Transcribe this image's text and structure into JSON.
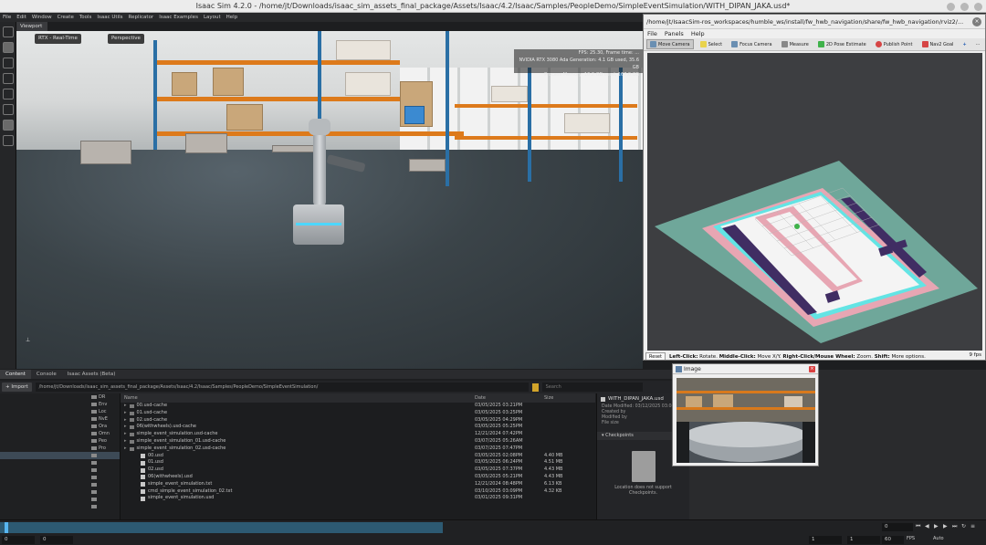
{
  "isaac": {
    "title": "Isaac Sim 4.2.0 - /home/jt/Downloads/isaac_sim_assets_final_package/Assets/Isaac/4.2/Isaac/Samples/PeopleDemo/SimpleEventSimulation/WITH_DIPAN_JAKA.usd*",
    "menu": [
      "File",
      "Edit",
      "Window",
      "Create",
      "Tools",
      "Isaac Utils",
      "Replicator",
      "Isaac Examples",
      "Layout",
      "Help"
    ],
    "viewport_tab": "Viewport",
    "viewport_buttons": {
      "render_mode": "RTX - Real-Time",
      "camera": "Perspective"
    },
    "perf": {
      "line1": "FPS: 25.30, Frame time: ...",
      "line2": "NVIDIA RTX 3080 Ada Generation: 4.1 GB used, 35.6 GB",
      "line3": "Process Memory: 10.2 GB used, 167.0 GB"
    }
  },
  "content": {
    "tabs": [
      "Content",
      "Console",
      "Isaac Assets (Beta)"
    ],
    "import_label": "+ Import",
    "path": "/home/jt/Downloads/isaac_sim_assets_final_package/Assets/Isaac/4.2/Isaac/Samples/PeopleDemo/SimpleEventSimulation/",
    "search_placeholder": "Search",
    "tree": [
      "DR",
      "Env",
      "Loc",
      "NvE",
      "Ora",
      "Omn",
      "Peo",
      "Pro",
      "",
      "",
      "",
      "",
      "",
      "",
      "",
      ""
    ],
    "columns": {
      "name": "Name",
      "date": "Date",
      "size": "Size"
    },
    "files": [
      {
        "name": "00.usd-cache",
        "date": "03/05/2025 03:21PM",
        "size": "",
        "kind": "folder"
      },
      {
        "name": "01.usd-cache",
        "date": "03/05/2025 03:25PM",
        "size": "",
        "kind": "folder"
      },
      {
        "name": "02.usd-cache",
        "date": "03/05/2025 04:29PM",
        "size": "",
        "kind": "folder"
      },
      {
        "name": "06(withwheels).usd-cache",
        "date": "03/05/2025 05:25PM",
        "size": "",
        "kind": "folder"
      },
      {
        "name": "simple_event_simulation.usd-cache",
        "date": "12/21/2024 07:42PM",
        "size": "",
        "kind": "folder"
      },
      {
        "name": "simple_event_simulation_01.usd-cache",
        "date": "03/07/2025 05:26AM",
        "size": "",
        "kind": "folder"
      },
      {
        "name": "simple_event_simulation_02.usd-cache",
        "date": "03/07/2025 07:47PM",
        "size": "",
        "kind": "folder"
      },
      {
        "name": "00.usd",
        "date": "03/05/2025 02:08PM",
        "size": "4.40 MB",
        "kind": "file"
      },
      {
        "name": "01.usd",
        "date": "03/05/2025 06:24PM",
        "size": "4.51 MB",
        "kind": "file"
      },
      {
        "name": "02.usd",
        "date": "03/05/2025 07:37PM",
        "size": "4.43 MB",
        "kind": "file"
      },
      {
        "name": "06(withwheels).usd",
        "date": "03/05/2025 05:21PM",
        "size": "4.43 MB",
        "kind": "file"
      },
      {
        "name": "simple_event_simulation.txt",
        "date": "12/21/2024 08:48PM",
        "size": "6.13 KB",
        "kind": "file"
      },
      {
        "name": "cmd_simple_event_simulation_02.txt",
        "date": "03/10/2025 03:09PM",
        "size": "4.32 KB",
        "kind": "file"
      },
      {
        "name": "simple_event_simulation.usd",
        "date": "03/01/2025 09:31PM",
        "size": "",
        "kind": "file"
      }
    ],
    "detail": {
      "name": "WITH_DIPAN_JAKA.usd",
      "date_modified": "Date Modified: 03/12/2025 03:08...",
      "created_by": "Created by",
      "modified_by": "Modified by",
      "file_size": "File size",
      "file_size_value": "11.7...",
      "checkpoints": "Checkpoints",
      "no_support_1": "Location does not support",
      "no_support_2": "Checkpoints."
    }
  },
  "timeline": {
    "start": "0",
    "start2": "0",
    "end": "1",
    "end2": "1",
    "current": "0",
    "fps_value": "60",
    "fps_label": "FPS",
    "auto": "Auto"
  },
  "rviz": {
    "title": "/home/jt/IsaacSim-ros_workspaces/humble_ws/install/fw_hwb_navigation/share/fw_hwb_navigation/rviz2/...",
    "menu": [
      "File",
      "Panels",
      "Help"
    ],
    "tools": [
      {
        "label": "Move Camera",
        "active": true
      },
      {
        "label": "Select",
        "active": false
      },
      {
        "label": "Focus Camera",
        "active": false
      },
      {
        "label": "Measure",
        "active": false
      },
      {
        "label": "2D Pose Estimate",
        "active": false
      },
      {
        "label": "Publish Point",
        "active": false
      },
      {
        "label": "Nav2 Goal",
        "active": false
      }
    ],
    "reset": "Reset",
    "status": {
      "left_bold": "Left-Click:",
      "left": " Rotate. ",
      "middle_bold": "Middle-Click:",
      "middle": " Move X/Y. ",
      "right_bold": "Right-Click/Mouse Wheel:",
      "right": " Zoom. ",
      "shift_bold": "Shift:",
      "shift": " More options."
    },
    "fps": "9 fps"
  },
  "image_window": {
    "title": "Image"
  },
  "colors": {
    "accent": "#58b6f0",
    "map_bg": "#6fa79a",
    "map_inflation": "#e7a6b3",
    "map_free": "#f4f4f4",
    "map_wall": "#402d63",
    "map_cyan": "#63e4e4"
  }
}
